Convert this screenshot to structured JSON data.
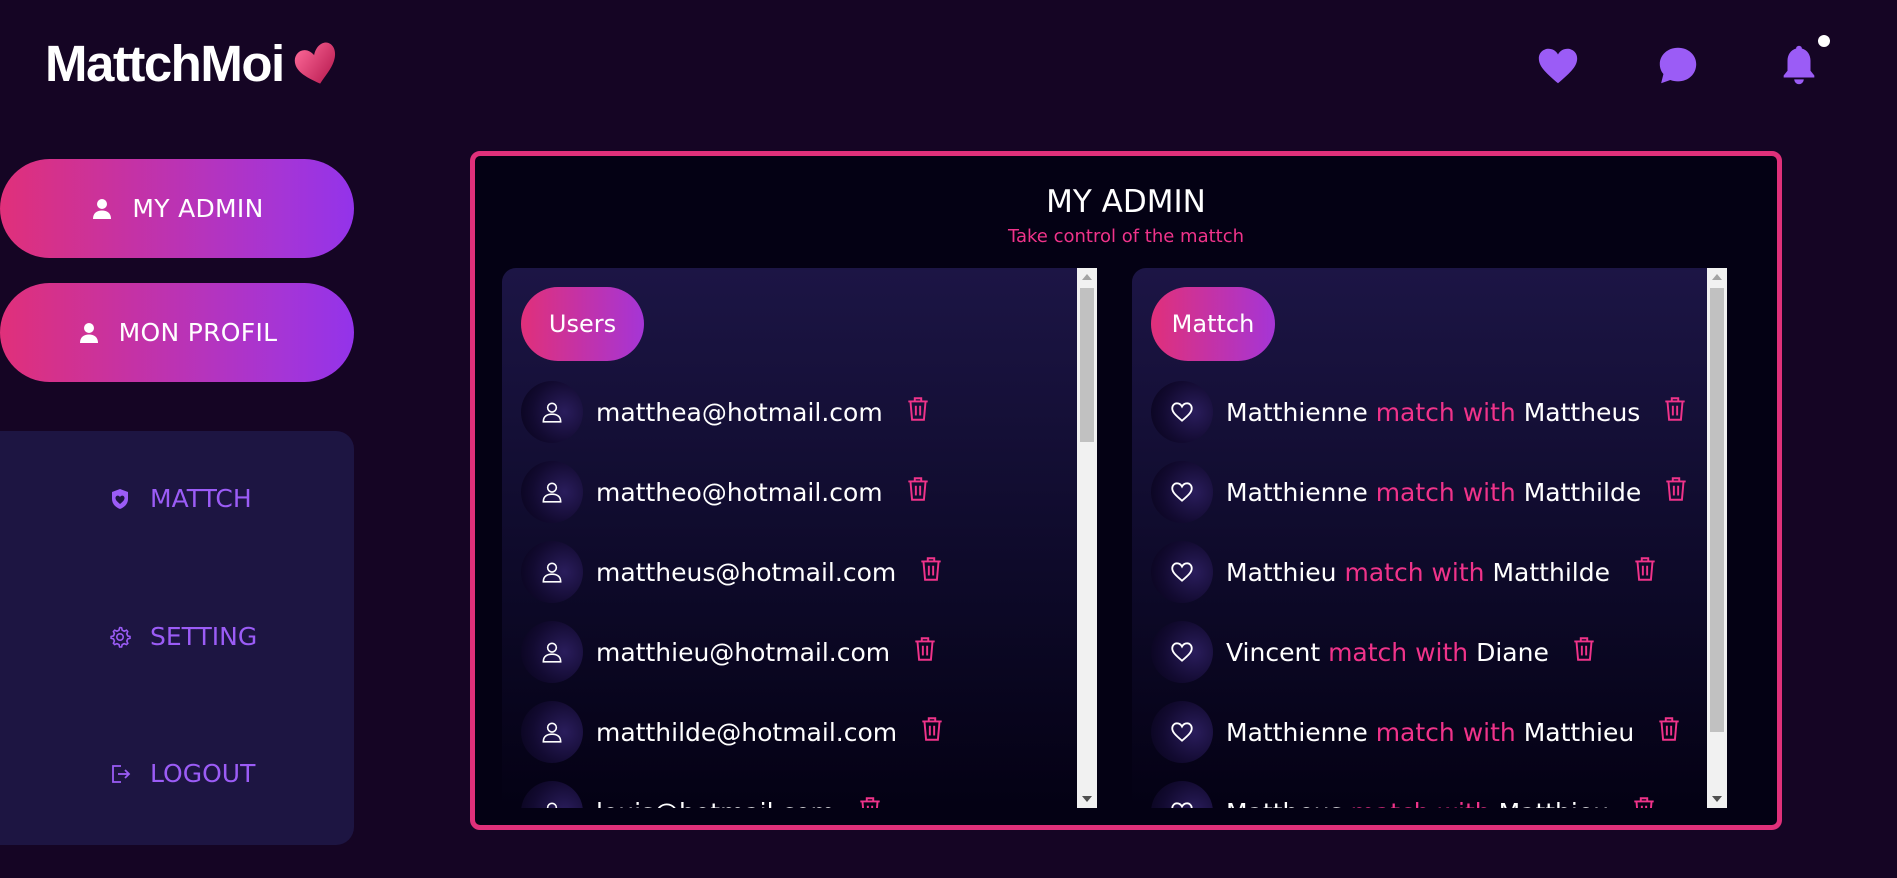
{
  "brand": {
    "name": "MattchMoi"
  },
  "header": {
    "icons": [
      "heart-icon",
      "chat-icon",
      "bell-icon"
    ]
  },
  "nav": {
    "my_admin": "MY ADMIN",
    "mon_profil": "MON PROFIL",
    "side": [
      {
        "label": "MATTCH",
        "icon": "heart-shield-icon"
      },
      {
        "label": "SETTING",
        "icon": "gear-icon"
      },
      {
        "label": "LOGOUT",
        "icon": "logout-icon"
      }
    ]
  },
  "admin": {
    "title": "MY ADMIN",
    "subtitle": "Take control of the mattch",
    "users": {
      "label": "Users",
      "items": [
        "matthea@hotmail.com",
        "mattheo@hotmail.com",
        "mattheus@hotmail.com",
        "matthieu@hotmail.com",
        "matthilde@hotmail.com",
        "louis@hotmail.com"
      ]
    },
    "match": {
      "label": "Mattch",
      "connector": "match with",
      "items": [
        {
          "a": "Matthienne",
          "b": "Mattheus"
        },
        {
          "a": "Matthienne",
          "b": "Matthilde"
        },
        {
          "a": "Matthieu",
          "b": "Matthilde"
        },
        {
          "a": "Vincent",
          "b": "Diane"
        },
        {
          "a": "Matthienne",
          "b": "Matthieu"
        },
        {
          "a": "Mattheus",
          "b": "Matthieu"
        }
      ]
    }
  },
  "colors": {
    "accent_pink": "#e0307a",
    "accent_purple": "#9333ea",
    "background": "#150524",
    "panel": "#1d1542"
  }
}
